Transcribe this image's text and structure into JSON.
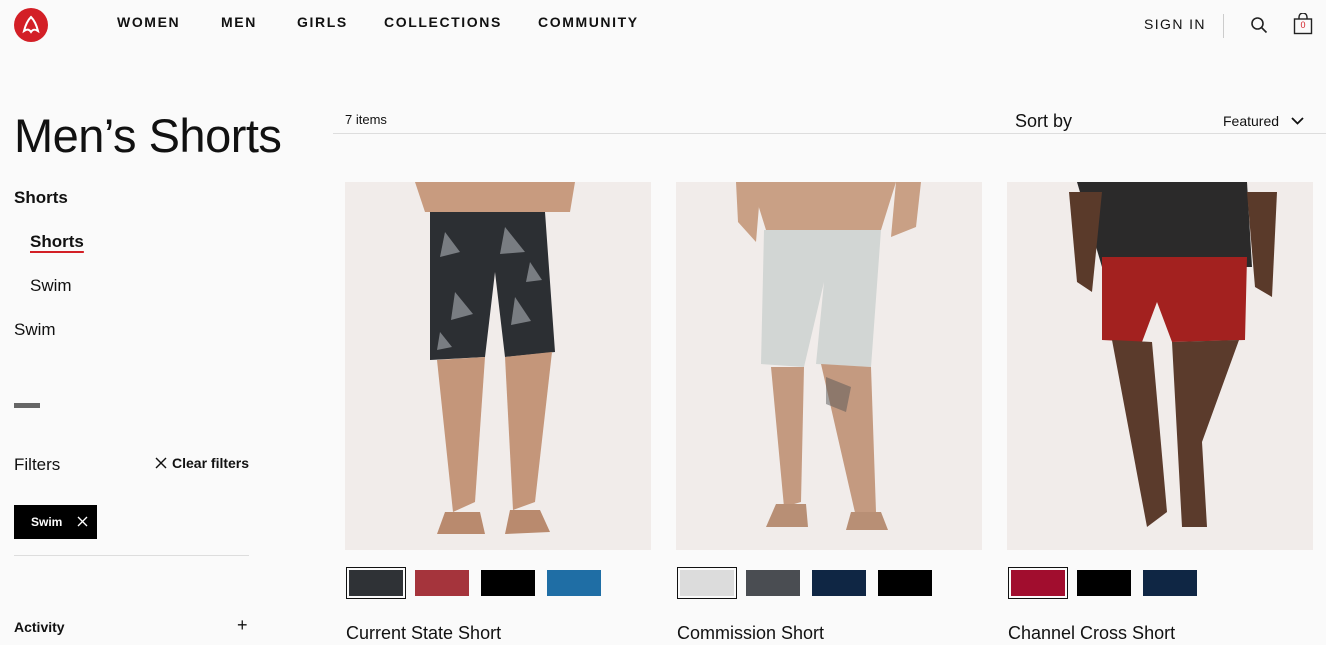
{
  "header": {
    "logo": "lululemon-logo",
    "nav": [
      "WOMEN",
      "MEN",
      "GIRLS",
      "COLLECTIONS",
      "COMMUNITY"
    ],
    "sign_in": "SIGN IN",
    "bag_count": "0"
  },
  "sidebar": {
    "title": "Men’s Shorts",
    "categories": [
      {
        "label": "Shorts"
      },
      {
        "label": "Shorts"
      },
      {
        "label": "Swim"
      },
      {
        "label": "Swim"
      }
    ],
    "filters_label": "Filters",
    "clear_filters": "Clear filters",
    "active_filter": "Swim",
    "activity_label": "Activity"
  },
  "toolbar": {
    "items_count": "7 items",
    "sort_label": "Sort by",
    "sort_value": "Featured"
  },
  "products": [
    {
      "name": "Current State Short",
      "swatches": [
        "#2f3236",
        "#a5343c",
        "#000000",
        "#1f6ea5"
      ],
      "selected": 0
    },
    {
      "name": "Commission Short",
      "swatches": [
        "#dcdcdc",
        "#4a4d52",
        "#0f2644",
        "#000000"
      ],
      "selected": 0
    },
    {
      "name": "Channel Cross Short",
      "swatches": [
        "#a10d2e",
        "#000000",
        "#0f2644"
      ],
      "selected": 0
    }
  ],
  "colors": {
    "brand_red": "#d31f26",
    "image_bg": "#f1ecea"
  }
}
